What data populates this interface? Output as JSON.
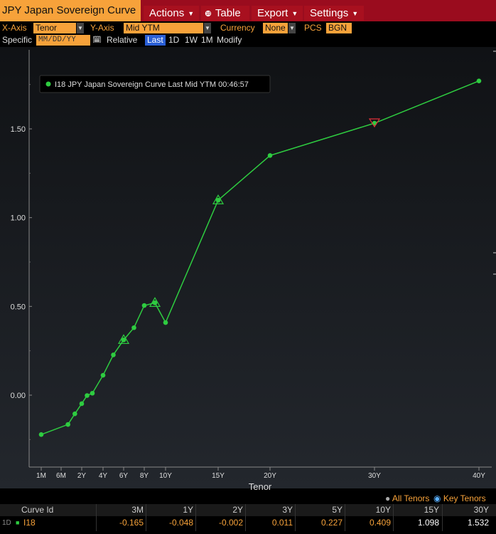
{
  "header": {
    "title": "JPY Japan Sovereign Curve",
    "menus": [
      {
        "label": "Actions"
      },
      {
        "label": "Table"
      },
      {
        "label": "Export"
      },
      {
        "label": "Settings"
      }
    ]
  },
  "controls": {
    "xaxis_label": "X-Axis",
    "xaxis_value": "Tenor",
    "yaxis_label": "Y-Axis",
    "yaxis_value": "Mid YTM",
    "currency_label": "Currency",
    "currency_value": "None",
    "pcs_label": "PCS",
    "pcs_value": "BGN",
    "specific_label": "Specific",
    "date_placeholder": "MM/DD/YY",
    "relative_label": "Relative",
    "ranges": [
      "Last",
      "1D",
      "1W",
      "1M"
    ],
    "modify_label": "Modify"
  },
  "footer": {
    "all_tenors": "All Tenors",
    "key_tenors": "Key Tenors"
  },
  "table": {
    "headers": [
      "Curve Id",
      "3M",
      "1Y",
      "2Y",
      "3Y",
      "5Y",
      "10Y",
      "15Y",
      "30Y"
    ],
    "row": {
      "prefix": "1D",
      "name": "I18",
      "values": [
        "-0.165",
        "-0.048",
        "-0.002",
        "0.011",
        "0.227",
        "0.409",
        "1.098",
        "1.532"
      ]
    }
  },
  "colors": {
    "accent": "#f7a23a",
    "menubar": "#9a0c1e",
    "line": "#2ecc40",
    "marker_highlight": "#e0303a"
  },
  "chart_data": {
    "type": "line",
    "legend": "I18 JPY Japan Sovereign Curve Last Mid YTM 00:46:57",
    "xlabel": "Tenor",
    "ylabel": "",
    "tick_labels_x": [
      "1M",
      "6M",
      "2Y",
      "4Y",
      "6Y",
      "8Y",
      "10Y",
      "15Y",
      "20Y",
      "30Y",
      "40Y"
    ],
    "tick_positions_x": [
      0.0833,
      0.5,
      2,
      4,
      6,
      8,
      10,
      15,
      20,
      30,
      40
    ],
    "tick_labels_y": [
      "0.00",
      "0.50",
      "1.00",
      "1.50"
    ],
    "tick_values_y": [
      0,
      0.5,
      1,
      1.5
    ],
    "ylim": [
      -0.27,
      1.8
    ],
    "grid": false,
    "legend_position": "top-left",
    "series": [
      {
        "name": "I18",
        "points": [
          {
            "x": 0.0833,
            "y": -0.222
          },
          {
            "x": 1,
            "y": -0.165,
            "key": false
          },
          {
            "x": 1.5,
            "y": -0.105
          },
          {
            "x": 2.0,
            "y": -0.048
          },
          {
            "x": 2.5,
            "y": -0.002
          },
          {
            "x": 3,
            "y": 0.011
          },
          {
            "x": 4,
            "y": 0.112
          },
          {
            "x": 5,
            "y": 0.227
          },
          {
            "x": 6,
            "y": 0.311,
            "key": true
          },
          {
            "x": 7,
            "y": 0.38
          },
          {
            "x": 8,
            "y": 0.505
          },
          {
            "x": 9,
            "y": 0.52,
            "key": true
          },
          {
            "x": 10,
            "y": 0.409
          },
          {
            "x": 15,
            "y": 1.098,
            "key": true
          },
          {
            "x": 20,
            "y": 1.35
          },
          {
            "x": 30,
            "y": 1.532,
            "key": true,
            "highlight": true
          },
          {
            "x": 40,
            "y": 1.77
          }
        ]
      }
    ]
  }
}
